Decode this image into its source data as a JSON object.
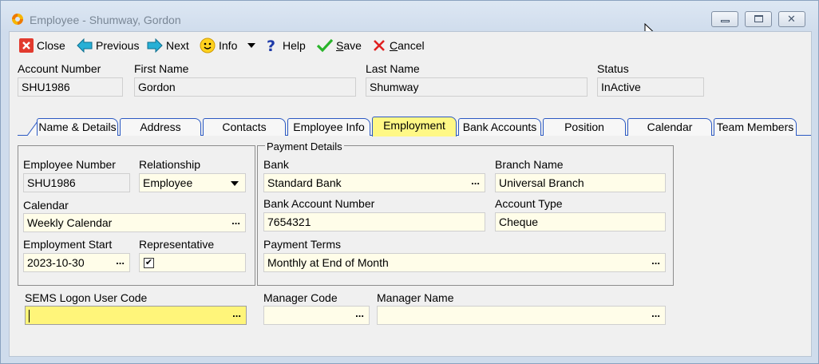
{
  "window": {
    "title": "Employee - Shumway, Gordon"
  },
  "toolbar": {
    "close": "Close",
    "previous": "Previous",
    "next": "Next",
    "info": "Info",
    "help": "Help",
    "save_first": "S",
    "save_rest": "ave",
    "cancel_first": "C",
    "cancel_rest": "ancel"
  },
  "header": {
    "account_number_label": "Account Number",
    "account_number": "SHU1986",
    "first_name_label": "First Name",
    "first_name": "Gordon",
    "last_name_label": "Last Name",
    "last_name": "Shumway",
    "status_label": "Status",
    "status": "InActive"
  },
  "tabs": [
    {
      "label": "Name & Details"
    },
    {
      "label": "Address"
    },
    {
      "label": "Contacts"
    },
    {
      "label": "Employee Info"
    },
    {
      "label": "Employment",
      "active": true
    },
    {
      "label": "Bank Accounts"
    },
    {
      "label": "Position"
    },
    {
      "label": "Calendar"
    },
    {
      "label": "Team Members"
    }
  ],
  "employment": {
    "employee_number_label": "Employee Number",
    "employee_number": "SHU1986",
    "relationship_label": "Relationship",
    "relationship": "Employee",
    "calendar_label": "Calendar",
    "calendar": "Weekly Calendar",
    "employment_start_label": "Employment Start",
    "employment_start": "2023-10-30",
    "representative_label": "Representative",
    "representative_checked": true,
    "representative_mark": "✔"
  },
  "payment": {
    "group_title": "Payment Details",
    "bank_label": "Bank",
    "bank": "Standard Bank",
    "branch_name_label": "Branch Name",
    "branch_name": "Universal Branch",
    "bank_account_number_label": "Bank Account Number",
    "bank_account_number": "7654321",
    "account_type_label": "Account Type",
    "account_type": "Cheque",
    "payment_terms_label": "Payment Terms",
    "payment_terms": "Monthly at End of Month"
  },
  "bottom": {
    "sems_logon_label": "SEMS Logon User Code",
    "sems_logon": "",
    "manager_code_label": "Manager Code",
    "manager_code": "",
    "manager_name_label": "Manager Name",
    "manager_name": ""
  },
  "ellipsis": "...",
  "colors": {
    "tab_border": "#2b59c3",
    "active_tab": "#fff886",
    "editable_field": "#fffde9",
    "focused_field": "#fff57a"
  }
}
